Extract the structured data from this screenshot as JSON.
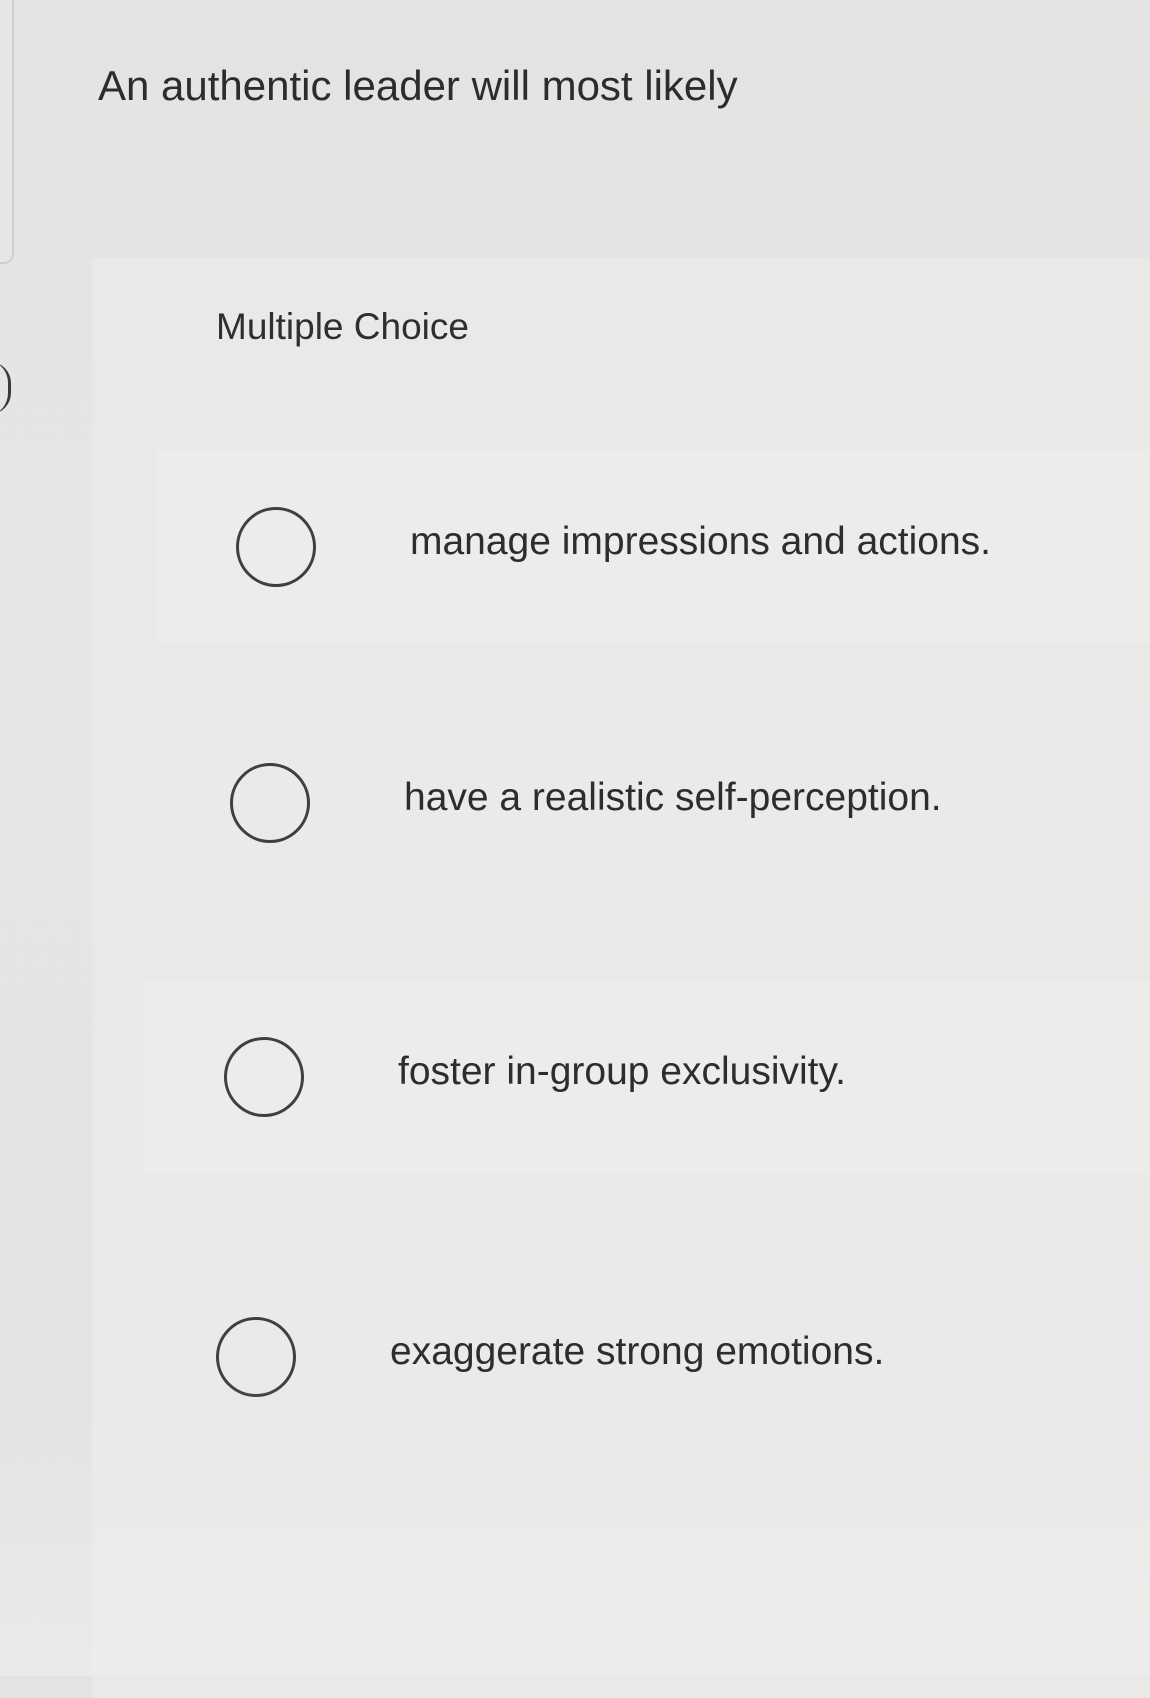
{
  "question": {
    "text": "An authentic leader will most likely"
  },
  "card": {
    "label": "Multiple Choice"
  },
  "options": [
    {
      "label": "manage impressions and actions.",
      "selected": false
    },
    {
      "label": "have a realistic self-perception.",
      "selected": false
    },
    {
      "label": "foster in-group exclusivity.",
      "selected": false
    },
    {
      "label": "exaggerate strong emotions.",
      "selected": false
    }
  ],
  "colors": {
    "background": "#e4e4e3",
    "card": "#e9e9e8",
    "text": "#2d2d2d",
    "radio_border": "#3f3f3f"
  },
  "icons": {
    "option_radio": "radio-unchecked-icon"
  }
}
